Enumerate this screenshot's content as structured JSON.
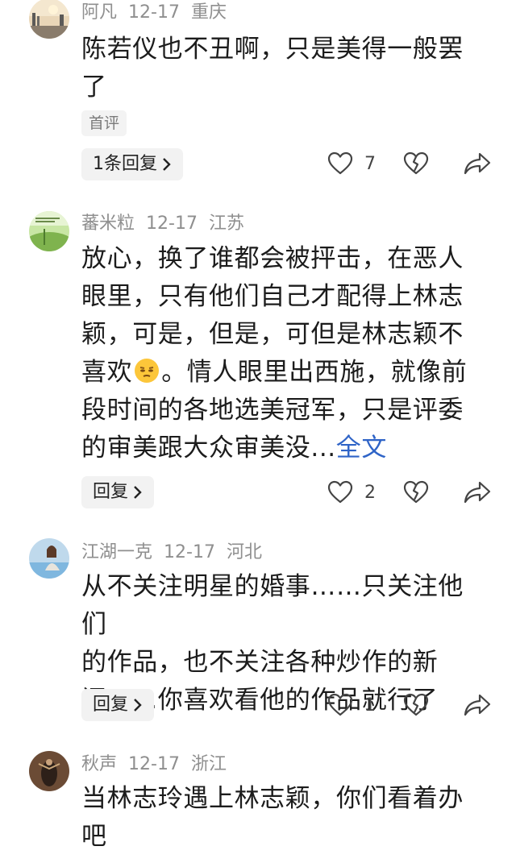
{
  "comments": [
    {
      "user": "阿凡",
      "date": "12-17",
      "location": "重庆",
      "text_lines": [
        "陈若仪也不丑啊，只是美得一般罢",
        "了"
      ],
      "tag": "首评",
      "reply_label": "1条回复",
      "likes": "7"
    },
    {
      "user": "蕃米粒",
      "date": "12-17",
      "location": "江苏",
      "text_lines": [
        "放心，换了谁都会被抨击，在恶人",
        "眼里，只有他们自己才配得上林志",
        "颖，可是，但是，可但是林志颖不"
      ],
      "line4_before": "喜欢",
      "line4_after": "。情人眼里出西施，就像前",
      "text_lines_b": [
        "段时间的各地选美冠军，只是评委"
      ],
      "line6_before": "的审美跟大众审美没...",
      "more_label": "全文",
      "reply_label": "回复",
      "likes": "2"
    },
    {
      "user": "江湖一克",
      "date": "12-17",
      "location": "河北",
      "text_lines": [
        "从不关注明星的婚事……只关注他们",
        "的作品，也不关注各种炒作的新",
        "闻……你喜欢看他的作品就行了"
      ],
      "reply_label": "回复",
      "likes": "1"
    },
    {
      "user": "秋声",
      "date": "12-17",
      "location": "浙江",
      "text_lines": [
        "当林志玲遇上林志颖，你们看着办",
        "吧"
      ]
    }
  ],
  "icons": {
    "like": "heart-outline-icon",
    "dislike": "broken-heart-icon",
    "share": "share-arrow-icon",
    "chevron": "chevron-right-icon"
  },
  "colors": {
    "link": "#2f64c7",
    "meta": "#8f8f8f",
    "text": "#1c1c1c"
  }
}
